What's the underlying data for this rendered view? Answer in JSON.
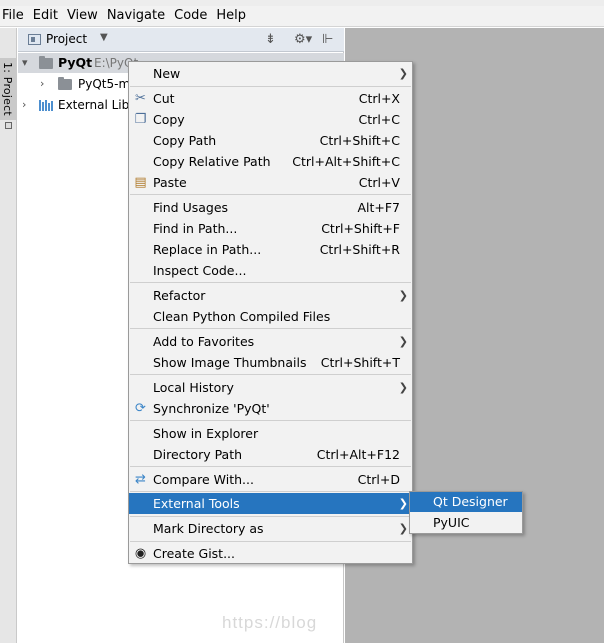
{
  "menubar": [
    "File",
    "Edit",
    "View",
    "Navigate",
    "Code",
    "Help"
  ],
  "tool_stripe": {
    "project_tab": "1: Project"
  },
  "project_panel": {
    "title": "Project",
    "tree": [
      {
        "label": "PyQt",
        "path": "E:\\PyQt"
      },
      {
        "label": "PyQt5-m"
      },
      {
        "label": "External Libr"
      }
    ]
  },
  "context_menu": {
    "items": [
      {
        "label": "New",
        "shortcut": "",
        "submenu": true
      },
      {
        "label": "Cut",
        "shortcut": "Ctrl+X",
        "icon": "scissors-icon"
      },
      {
        "label": "Copy",
        "shortcut": "Ctrl+C",
        "icon": "copy-icon"
      },
      {
        "label": "Copy Path",
        "shortcut": "Ctrl+Shift+C"
      },
      {
        "label": "Copy Relative Path",
        "shortcut": "Ctrl+Alt+Shift+C"
      },
      {
        "label": "Paste",
        "shortcut": "Ctrl+V",
        "icon": "paste-icon"
      },
      {
        "label": "Find Usages",
        "shortcut": "Alt+F7"
      },
      {
        "label": "Find in Path...",
        "shortcut": "Ctrl+Shift+F"
      },
      {
        "label": "Replace in Path...",
        "shortcut": "Ctrl+Shift+R"
      },
      {
        "label": "Inspect Code...",
        "shortcut": ""
      },
      {
        "label": "Refactor",
        "shortcut": "",
        "submenu": true
      },
      {
        "label": "Clean Python Compiled Files",
        "shortcut": ""
      },
      {
        "label": "Add to Favorites",
        "shortcut": "",
        "submenu": true
      },
      {
        "label": "Show Image Thumbnails",
        "shortcut": "Ctrl+Shift+T"
      },
      {
        "label": "Local History",
        "shortcut": "",
        "submenu": true
      },
      {
        "label": "Synchronize 'PyQt'",
        "shortcut": "",
        "icon": "sync-icon"
      },
      {
        "label": "Show in Explorer",
        "shortcut": ""
      },
      {
        "label": "Directory Path",
        "shortcut": "Ctrl+Alt+F12"
      },
      {
        "label": "Compare With...",
        "shortcut": "Ctrl+D",
        "icon": "compare-icon"
      },
      {
        "label": "External Tools",
        "shortcut": "",
        "submenu": true,
        "highlighted": true
      },
      {
        "label": "Mark Directory as",
        "shortcut": "",
        "submenu": true
      },
      {
        "label": "Create Gist...",
        "shortcut": "",
        "icon": "github-icon"
      }
    ]
  },
  "submenu": {
    "items": [
      {
        "label": "Qt Designer",
        "highlighted": true
      },
      {
        "label": "PyUIC"
      }
    ]
  },
  "watermark": "https://blog",
  "colors": {
    "highlight": "#2675bf",
    "editor_bg": "#b3b3b3",
    "menu_bg": "#f2f2f2"
  }
}
